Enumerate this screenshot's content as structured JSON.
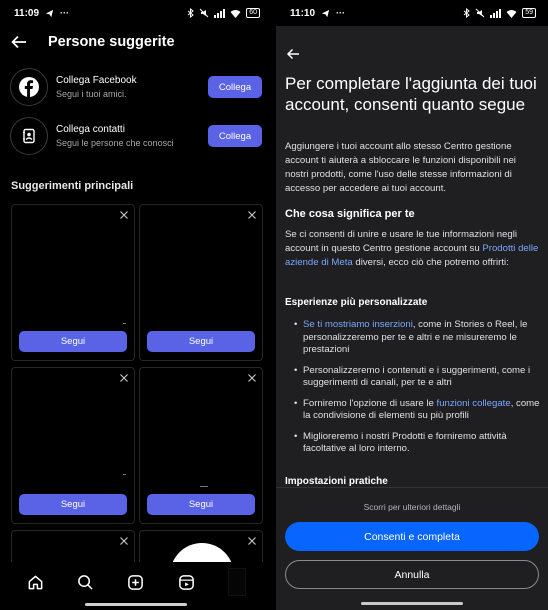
{
  "left": {
    "status": {
      "time": "11:09",
      "battery": "60"
    },
    "title": "Persone suggerite",
    "rows": [
      {
        "title": "Collega Facebook",
        "sub": "Segui i tuoi amici.",
        "button": "Collega"
      },
      {
        "title": "Collega contatti",
        "sub": "Segui le persone che conosci",
        "button": "Collega"
      }
    ],
    "section": "Suggerimenti principali",
    "cards": [
      {
        "button": "Segui"
      },
      {
        "button": "Segui"
      },
      {
        "button": "Segui"
      },
      {
        "button": "Segui"
      }
    ],
    "nav": [
      "home-icon",
      "search-icon",
      "create-icon",
      "reels-icon",
      "profile-icon"
    ]
  },
  "right": {
    "status": {
      "time": "11:10",
      "battery": "59"
    },
    "heading": "Per completare l'aggiunta dei tuoi account, consenti quanto segue",
    "intro": "Aggiungere i tuoi account allo stesso Centro gestione account ti aiuterà a sbloccare le funzioni disponibili nei nostri prodotti, come l'uso delle stesse informazioni di accesso per accedere ai tuoi account.",
    "what_means": "Che cosa significa per te",
    "consent_pre": "Se ci consenti di unire e usare le tue informazioni negli account in questo Centro gestione account su ",
    "consent_link": "Prodotti delle aziende di Meta",
    "consent_post": " diversi, ecco ciò che potremo offrirti:",
    "exp_title": "Esperienze più personalizzate",
    "b1_link": "Se ti mostriamo inserzioni",
    "b1_rest": ", come in Stories o Reel, le personalizzeremo per te e altri e ne misureremo le prestazioni",
    "b2": "Personalizzeremo i contenuti e i suggerimenti, come i suggerimenti di canali, per te e altri",
    "b3_pre": "Forniremo l'opzione di usare le ",
    "b3_link": "funzioni collegate",
    "b3_post": ", come la condivisione di elementi su più profili",
    "b4": "Miglioreremo i nostri Prodotti e forniremo attività facoltative al loro interno.",
    "practical": "Impostazioni pratiche",
    "scroll_hint": "Scorri per ulteriori dettagli",
    "primary_btn": "Consenti e completa",
    "secondary_btn": "Annulla"
  },
  "colors": {
    "accent": "#5a62e6",
    "meta_blue": "#0866ff",
    "link": "#7aa7ff"
  }
}
